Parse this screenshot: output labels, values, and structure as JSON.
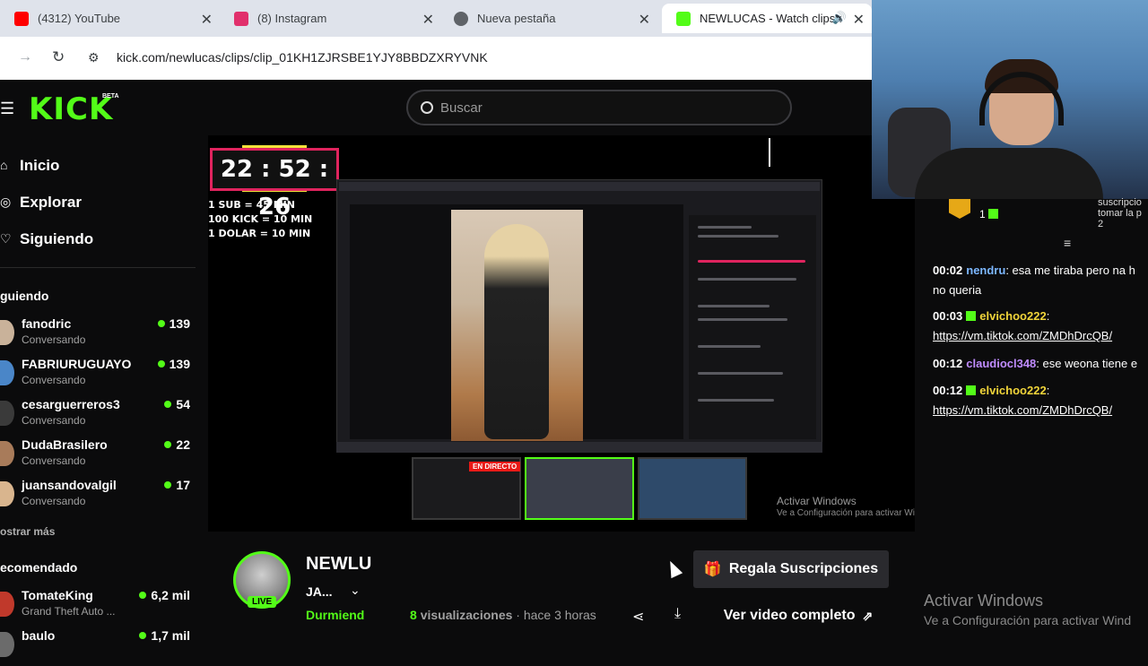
{
  "browser": {
    "tabs": [
      {
        "label": "(4312) YouTube",
        "color": "#ff0000"
      },
      {
        "label": "(8) Instagram",
        "color": "#e1306c"
      },
      {
        "label": "Nueva pestaña",
        "color": "#5f6368"
      },
      {
        "label": "NEWLUCAS - Watch clips o",
        "color": "#53fc18"
      }
    ],
    "url": "kick.com/newlucas/clips/clip_01KH1ZJRSBE1YJY8BBDZXRYVNK"
  },
  "header": {
    "logo": "KICK",
    "beta": "BETA",
    "search_placeholder": "Buscar"
  },
  "sidebar": {
    "nav": [
      "Inicio",
      "Explorar",
      "Siguiendo"
    ],
    "following_title": "guiendo",
    "following": [
      {
        "name": "fanodric",
        "status": "Conversando",
        "viewers": "139"
      },
      {
        "name": "FABRIURUGUAYO",
        "status": "Conversando",
        "viewers": "139"
      },
      {
        "name": "cesarguerreros3",
        "status": "Conversando",
        "viewers": "54"
      },
      {
        "name": "DudaBrasilero",
        "status": "Conversando",
        "viewers": "22"
      },
      {
        "name": "juansandovalgil",
        "status": "Conversando",
        "viewers": "17"
      }
    ],
    "show_more": "ostrar más",
    "recommended_title": "ecomendado",
    "recommended": [
      {
        "name": "TomateKing",
        "status": "Grand Theft Auto ...",
        "viewers": "6,2 mil"
      },
      {
        "name": "baulo",
        "status": "",
        "viewers": "1,7 mil"
      }
    ]
  },
  "video": {
    "timer": "22 : 52 : 26",
    "rules": [
      "1 SUB = 45 MIN",
      "100 KICK = 10 MIN",
      "1 DOLAR = 10 MIN"
    ],
    "en_directo": "EN DIRECTO",
    "watermark_title": "Activar Windows",
    "watermark_sub": "Ve a Configuración para activar Wind"
  },
  "chat": {
    "messages": [
      {
        "time": "00:02",
        "user": "nendru",
        "color": "#7cb7ff",
        "text": ": esa me tiraba pero na h",
        "text2": "no queria",
        "sub": false
      },
      {
        "time": "00:03",
        "user": "elvichoo222",
        "color": "#f0d43a",
        "text": ":",
        "link": "https://vm.tiktok.com/ZMDhDrcQB/",
        "sub": true
      },
      {
        "time": "00:12",
        "user": "claudiocl348",
        "color": "#c08cff",
        "text": ": ese weona tiene e",
        "sub": false
      },
      {
        "time": "00:12",
        "user": "elvichoo222",
        "color": "#f0d43a",
        "text": ":",
        "link": "https://vm.tiktok.com/ZMDhDrcQB/",
        "sub": true
      }
    ],
    "top_user_count": "1",
    "top_right": [
      "suscripcio",
      "tomar la p",
      "2"
    ]
  },
  "channel": {
    "name": "NEWLU",
    "title": "JA...",
    "category": "Durmiend",
    "views_count": "8",
    "views_label": "visualizaciones",
    "time_ago": "· hace 3 horas",
    "live": "LIVE",
    "gift_label": "Regala Suscripciones",
    "full_video_label": "Ver video completo"
  },
  "watermark": {
    "title": "Activar Windows",
    "sub": "Ve a Configuración para activar Wind"
  }
}
